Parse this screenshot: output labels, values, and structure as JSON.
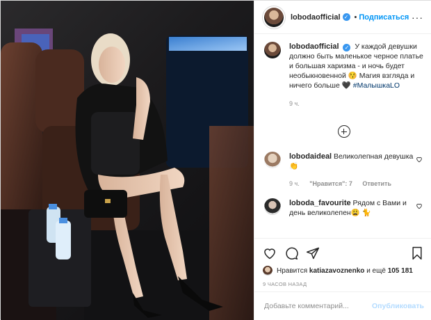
{
  "header": {
    "username": "lobodaofficial",
    "verified_glyph": "✓",
    "separator": "•",
    "follow_label": "Подписаться",
    "more_label": "···"
  },
  "caption": {
    "username": "lobodaofficial",
    "text": "У каждой девушки должно быть маленькое черное платье и большая харизма - и ночь будет необыкновенной 😚 Магия взгляда и ничего больше 🖤",
    "hashtag": "#МалышкаLO",
    "time": "9 ч."
  },
  "load_more_icon": "plus-circle-icon",
  "comments": [
    {
      "username": "lobodaideal",
      "text": "Великолепная девушка 👏",
      "time": "9 ч.",
      "likes": "\"Нравится\": 7",
      "reply": "Ответить"
    },
    {
      "username": "loboda_favourite",
      "text": "Рядом с Вами и день великолепен😩 🐈",
      "time": "",
      "likes": "",
      "reply": ""
    }
  ],
  "likes": {
    "prefix": "Нравится",
    "user": "katiazavoznenko",
    "middle": "и ещё",
    "count": "105 181"
  },
  "timestamp": "9 ЧАСОВ НАЗАД",
  "add_comment": {
    "placeholder": "Добавьте комментарий...",
    "publish_label": "Опубликовать"
  },
  "colors": {
    "accent": "#0095f6",
    "verified": "#3897f0",
    "muted": "#8e8e8e",
    "publish_disabled": "#b3dbff"
  }
}
